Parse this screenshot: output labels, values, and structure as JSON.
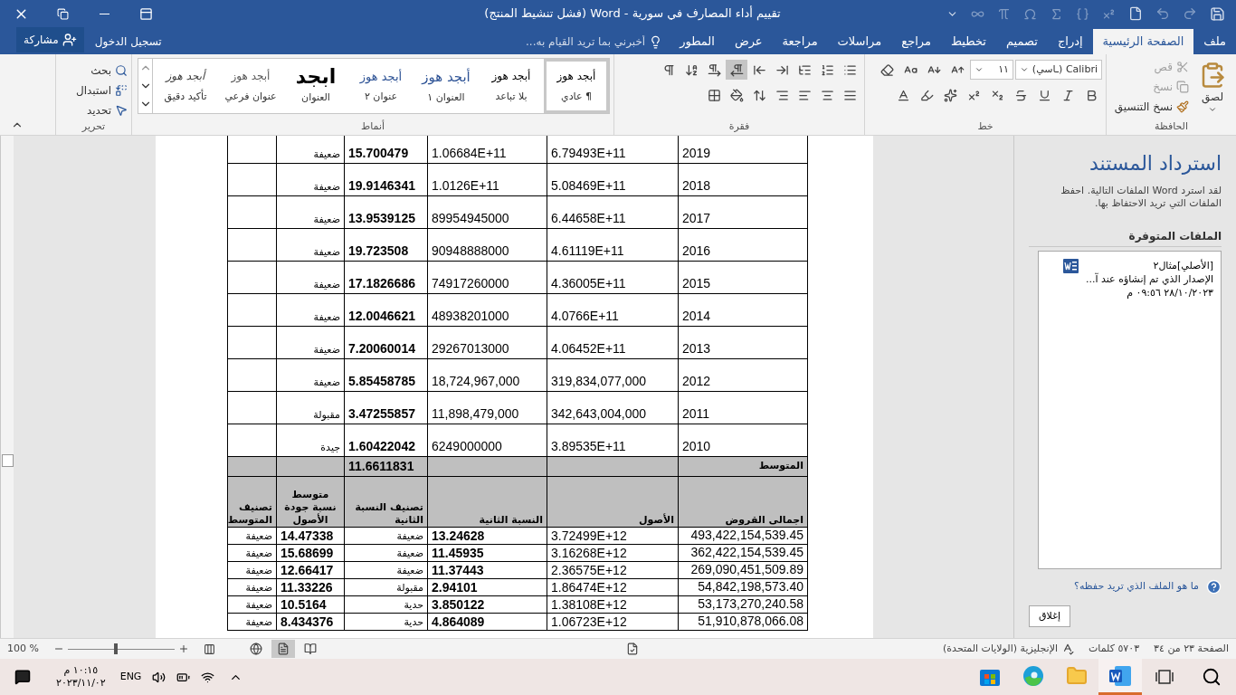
{
  "title_bar": {
    "title": "تقييم أداء المصارف في سورية - Word (فشل تنشيط المنتج)"
  },
  "tabs": [
    {
      "label": "ملف",
      "selected": false
    },
    {
      "label": "الصفحة الرئيسية",
      "selected": true
    },
    {
      "label": "إدراج",
      "selected": false
    },
    {
      "label": "تصميم",
      "selected": false
    },
    {
      "label": "تخطيط",
      "selected": false
    },
    {
      "label": "مراجع",
      "selected": false
    },
    {
      "label": "مراسلات",
      "selected": false
    },
    {
      "label": "مراجعة",
      "selected": false
    },
    {
      "label": "عرض",
      "selected": false
    },
    {
      "label": "المطور",
      "selected": false
    }
  ],
  "tell_me": {
    "placeholder": "أخبرني بما تريد القيام به..."
  },
  "sign_in": "تسجيل الدخول",
  "share": "مشاركة",
  "ribbon": {
    "clipboard": {
      "label": "الحافظة",
      "paste": "لصق",
      "actions": [
        {
          "kind": "cut",
          "label": "قص",
          "disabled": true
        },
        {
          "kind": "copy",
          "label": "نسخ",
          "disabled": true
        },
        {
          "kind": "format_painter",
          "label": "نسخ التنسيق",
          "disabled": false
        }
      ]
    },
    "font": {
      "label": "خط",
      "font_name": "Calibri (ـاسي)",
      "font_size": "١١"
    },
    "paragraph": {
      "label": "فقرة",
      "rtl_direction_on": true
    },
    "styles": {
      "label": "أنماط",
      "items": [
        {
          "kind": "normal",
          "preview": "أبجد هوز",
          "name": "¶ عادي",
          "selected": true
        },
        {
          "kind": "nospacing",
          "preview": "أبجد هوز",
          "name": "بلا تباعد",
          "selected": false
        },
        {
          "kind": "heading1",
          "preview": "أبجد هوز",
          "name": "العنوان ١",
          "selected": false
        },
        {
          "kind": "heading2",
          "preview": "أبجد هوز",
          "name": "عنوان ٢",
          "selected": false
        },
        {
          "kind": "title",
          "preview": "ابجد",
          "name": "العنوان",
          "selected": false
        },
        {
          "kind": "subtitle",
          "preview": "أبجد هوز",
          "name": "عنوان فرعي",
          "selected": false
        },
        {
          "kind": "emphasis",
          "preview": "أبجد هوز",
          "name": "تأكيد دقيق",
          "selected": false
        }
      ]
    },
    "editing": {
      "label": "تحرير",
      "actions": [
        {
          "kind": "find",
          "label": "بحث"
        },
        {
          "kind": "replace",
          "label": "استبدال"
        },
        {
          "kind": "select",
          "label": "تحديد"
        }
      ]
    }
  },
  "document": {
    "rows": [
      {
        "kind": "year",
        "year": "2019",
        "assets": "6.79493E+11",
        "loans": "1.06684E+11",
        "ratio": "15.700479",
        "rating": "ضعيفة"
      },
      {
        "kind": "year",
        "year": "2018",
        "assets": "5.08469E+11",
        "loans": "1.0126E+11",
        "ratio": "19.9146341",
        "rating": "ضعيفة"
      },
      {
        "kind": "year",
        "year": "2017",
        "assets": "6.44658E+11",
        "loans": "89954945000",
        "ratio": "13.9539125",
        "rating": "ضعيفة"
      },
      {
        "kind": "year",
        "year": "2016",
        "assets": "4.61119E+11",
        "loans": "90948888000",
        "ratio": "19.723508",
        "rating": "ضعيفة"
      },
      {
        "kind": "year",
        "year": "2015",
        "assets": "4.36005E+11",
        "loans": "74917260000",
        "ratio": "17.1826686",
        "rating": "ضعيفة"
      },
      {
        "kind": "year",
        "year": "2014",
        "assets": "4.0766E+11",
        "loans": "48938201000",
        "ratio": "12.0046621",
        "rating": "ضعيفة"
      },
      {
        "kind": "year",
        "year": "2013",
        "assets": "4.06452E+11",
        "loans": "29267013000",
        "ratio": "7.20060014",
        "rating": "ضعيفة"
      },
      {
        "kind": "year",
        "year": "2012",
        "assets": "319,834,077,000",
        "loans": "18,724,967,000",
        "ratio": "5.85458785",
        "rating": "ضعيفة"
      },
      {
        "kind": "year",
        "year": "2011",
        "assets": "342,643,004,000",
        "loans": "11,898,479,000",
        "ratio": "3.47255857",
        "rating": "مقبولة"
      },
      {
        "kind": "year",
        "year": "2010",
        "assets": "3.89535E+11",
        "loans": "6249000000",
        "ratio": "1.60422042",
        "rating": "جيدة"
      },
      {
        "kind": "average",
        "label": "المتوسط",
        "value": "11.6611831"
      },
      {
        "kind": "header",
        "columns": [
          "اجمالى القروض",
          "الأصول",
          "النسبة الثانية",
          "تصنيف النسبة الثانية",
          "متوسط نسبة جودة الأصول",
          "تصنيف المتوسط"
        ]
      },
      {
        "kind": "bank",
        "loans": "493,422,154,539.45",
        "assets": "3.72499E+12",
        "ratio2": "13.24628",
        "rating2": "ضعيفة",
        "average": "14.47338",
        "average_rating": "ضعيفة"
      },
      {
        "kind": "bank",
        "loans": "362,422,154,539.45",
        "assets": "3.16268E+12",
        "ratio2": "11.45935",
        "rating2": "ضعيفة",
        "average": "15.68699",
        "average_rating": "ضعيفة"
      },
      {
        "kind": "bank",
        "loans": "269,090,451,509.89",
        "assets": "2.36575E+12",
        "ratio2": "11.37443",
        "rating2": "ضعيفة",
        "average": "12.66417",
        "average_rating": "ضعيفة"
      },
      {
        "kind": "bank",
        "loans": "54,842,198,573.40",
        "assets": "1.86474E+12",
        "ratio2": "2.94101",
        "rating2": "مقبولة",
        "average": "11.33226",
        "average_rating": "ضعيفة"
      },
      {
        "kind": "bank",
        "loans": "53,173,270,240.58",
        "assets": "1.38108E+12",
        "ratio2": "3.850122",
        "rating2": "حدية",
        "average": "10.5164",
        "average_rating": "ضعيفة"
      },
      {
        "kind": "bank",
        "loans": "51,910,878,066.08",
        "assets": "1.06723E+12",
        "ratio2": "4.864089",
        "rating2": "حدية",
        "average": "8.434376",
        "average_rating": "ضعيفة"
      }
    ]
  },
  "recovery_pane": {
    "title": "استرداد المستند",
    "description": "لقد استرد Word الملفات التالية. احفظ الملفات التي تريد الاحتفاظ بها.",
    "section": "الملفات المتوفرة",
    "files": [
      {
        "name": "[الأصلي]مثال٢",
        "description": "الإصدار الذي تم إنشاؤه عند آ...",
        "date": "٢٨/١٠/٢٠٢٣ ٠٩:٥٦ م"
      }
    ],
    "help_link": "ما هو الملف الذي تريد حفظه؟",
    "close_button": "إغلاق"
  },
  "status_bar": {
    "page": "الصفحة ٢٣ من ٣٤",
    "words": "٥٧٠٣ كلمات",
    "language": "الإنجليزية (الولايات المتحدة)",
    "zoom_label": "100 %",
    "zoom": {
      "level": 0.45
    },
    "views": [
      {
        "kind": "read",
        "selected": false
      },
      {
        "kind": "print",
        "selected": true
      },
      {
        "kind": "web",
        "selected": false
      }
    ]
  },
  "taskbar": {
    "apps": [
      {
        "kind": "word",
        "selected": true
      },
      {
        "kind": "explorer",
        "selected": false
      },
      {
        "kind": "edge",
        "selected": false
      },
      {
        "kind": "store",
        "selected": false
      }
    ],
    "language": "ENG",
    "time": "١٠:١٥ م",
    "date": "٢٠٢٣/١١/٠٢"
  }
}
